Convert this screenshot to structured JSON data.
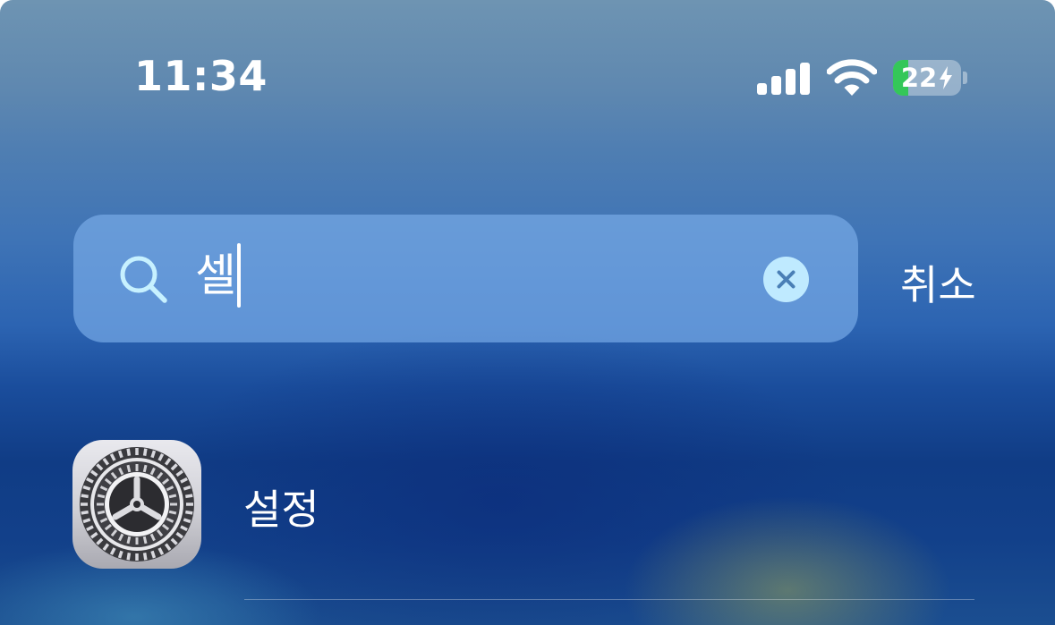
{
  "status_bar": {
    "time": "11:34",
    "battery_level": "22",
    "battery_fraction": 0.22,
    "charging": true,
    "signal_bars": 4,
    "icons": [
      "cellular-signal-icon",
      "wifi-icon",
      "battery-icon",
      "charging-bolt-icon"
    ]
  },
  "search": {
    "query": "셀",
    "icon": "search-icon",
    "clear_icon": "clear-icon",
    "cancel_label": "취소"
  },
  "results": [
    {
      "label": "설정",
      "icon": "settings-gear-icon"
    }
  ],
  "colors": {
    "search_icon": "#c7f1ff",
    "clear_button_bg": "#bfeaff",
    "clear_button_x": "#4a7fb6",
    "battery_fill": "#34c759"
  }
}
